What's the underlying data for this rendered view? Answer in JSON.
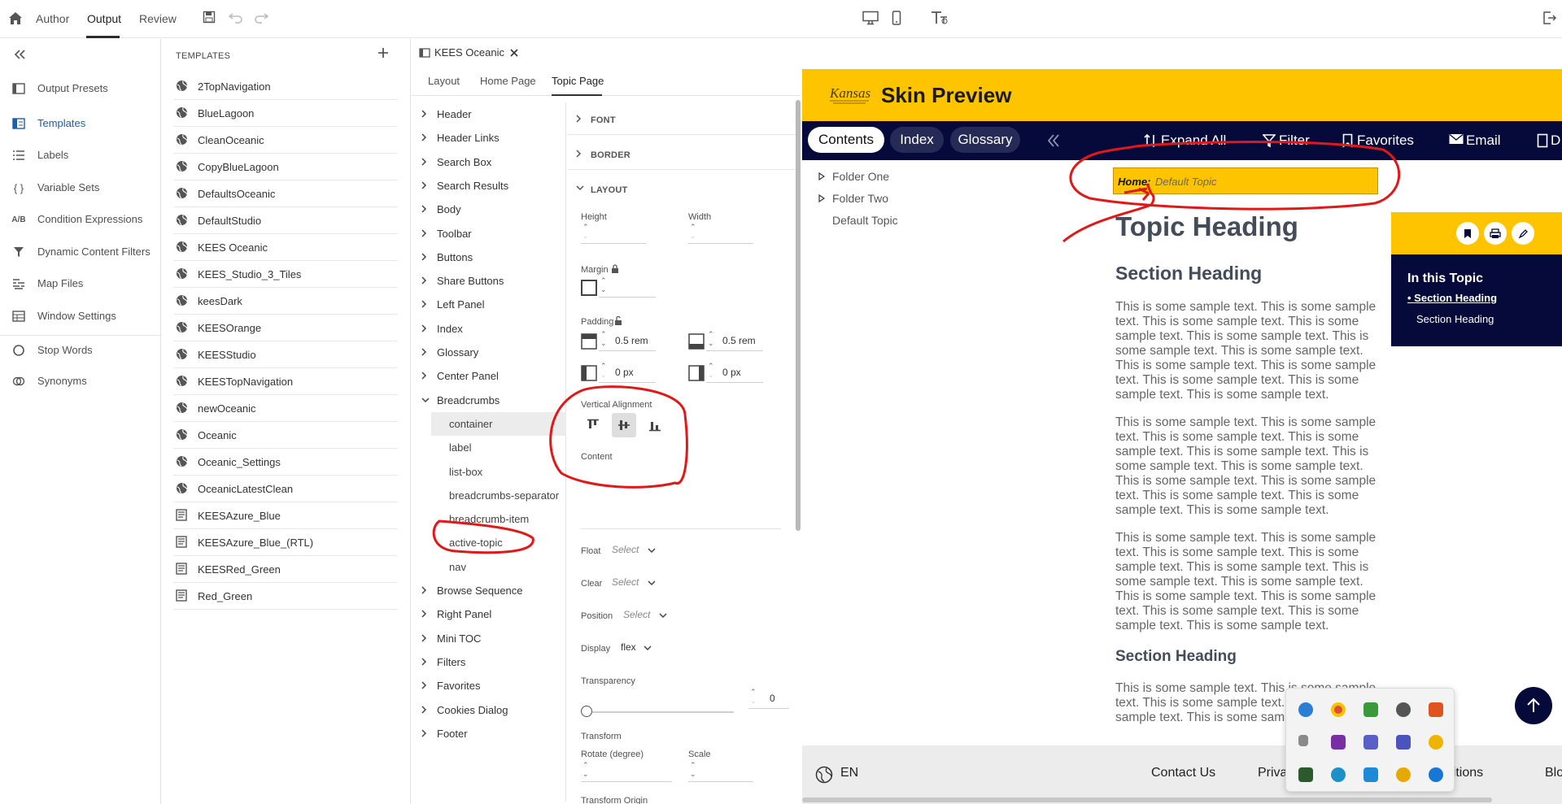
{
  "topbar": {
    "tabs": [
      {
        "label": "Author"
      },
      {
        "label": "Output"
      },
      {
        "label": "Review"
      }
    ]
  },
  "leftnav": {
    "items": [
      {
        "label": "Output Presets",
        "icon": "output-presets-icon"
      },
      {
        "label": "Templates",
        "icon": "templates-icon"
      },
      {
        "label": "Labels",
        "icon": "labels-icon"
      },
      {
        "label": "Variable Sets",
        "icon": "variable-sets-icon"
      },
      {
        "label": "Condition Expressions",
        "icon": "condition-expressions-icon",
        "glyph": "A/B"
      },
      {
        "label": "Dynamic Content Filters",
        "icon": "filter-icon"
      },
      {
        "label": "Map Files",
        "icon": "map-files-icon"
      },
      {
        "label": "Window Settings",
        "icon": "window-settings-icon"
      },
      {
        "label": "Stop Words",
        "icon": "stop-words-icon"
      },
      {
        "label": "Synonyms",
        "icon": "synonyms-icon"
      }
    ],
    "variable_sets_glyph": "{ }"
  },
  "templates": {
    "title": "TEMPLATES",
    "items": [
      {
        "label": "2TopNavigation"
      },
      {
        "label": "BlueLagoon"
      },
      {
        "label": "CleanOceanic"
      },
      {
        "label": "CopyBlueLagoon"
      },
      {
        "label": "DefaultsOceanic"
      },
      {
        "label": "DefaultStudio"
      },
      {
        "label": "KEES Oceanic"
      },
      {
        "label": "KEES_Studio_3_Tiles"
      },
      {
        "label": "keesDark"
      },
      {
        "label": "KEESOrange"
      },
      {
        "label": "KEESStudio"
      },
      {
        "label": "KEESTopNavigation"
      },
      {
        "label": "newOceanic"
      },
      {
        "label": "Oceanic"
      },
      {
        "label": "Oceanic_Settings"
      },
      {
        "label": "OceanicLatestClean"
      },
      {
        "label": "KEESAzure_Blue"
      },
      {
        "label": "KEESAzure_Blue_(RTL)"
      },
      {
        "label": "KEESRed_Green"
      },
      {
        "label": "Red_Green"
      }
    ]
  },
  "editor": {
    "tab_label": "KEES Oceanic",
    "subtabs": [
      {
        "label": "Layout"
      },
      {
        "label": "Home Page"
      },
      {
        "label": "Topic Page"
      }
    ],
    "tree": [
      {
        "label": "Header"
      },
      {
        "label": "Header Links"
      },
      {
        "label": "Search Box"
      },
      {
        "label": "Search Results"
      },
      {
        "label": "Body"
      },
      {
        "label": "Toolbar"
      },
      {
        "label": "Buttons"
      },
      {
        "label": "Share Buttons"
      },
      {
        "label": "Left Panel"
      },
      {
        "label": "Index"
      },
      {
        "label": "Glossary"
      },
      {
        "label": "Center Panel"
      },
      {
        "label": "Breadcrumbs"
      },
      {
        "label": "container"
      },
      {
        "label": "label"
      },
      {
        "label": "list-box"
      },
      {
        "label": "breadcrumbs-separator"
      },
      {
        "label": "breadcrumb-item"
      },
      {
        "label": "active-topic"
      },
      {
        "label": "nav"
      },
      {
        "label": "Browse Sequence"
      },
      {
        "label": "Right Panel"
      },
      {
        "label": "Mini TOC"
      },
      {
        "label": "Filters"
      },
      {
        "label": "Favorites"
      },
      {
        "label": "Cookies Dialog"
      },
      {
        "label": "Footer"
      }
    ]
  },
  "props": {
    "font": "FONT",
    "border": "BORDER",
    "layout": "LAYOUT",
    "height": "Height",
    "width": "Width",
    "margin": "Margin",
    "padding": "Padding",
    "pad_top": "0.5 rem",
    "pad_bottom": "0.5 rem",
    "pad_left": "0 px",
    "pad_right": "0 px",
    "vertical_alignment": "Vertical Alignment",
    "content": "Content",
    "float_label": "Float",
    "float_value": "Select",
    "clear_label": "Clear",
    "clear_value": "Select",
    "position_label": "Position",
    "position_value": "Select",
    "display_label": "Display",
    "display_value": "flex",
    "transparency": "Transparency",
    "transparency_value": "0",
    "transform": "Transform",
    "rotate": "Rotate (degree)",
    "scale": "Scale",
    "transform_origin": "Transform Origin"
  },
  "preview": {
    "logo_text": "Kansas",
    "title": "Skin Preview",
    "nav_tabs": [
      {
        "label": "Contents"
      },
      {
        "label": "Index"
      },
      {
        "label": "Glossary"
      }
    ],
    "tools": [
      {
        "label": "Expand All"
      },
      {
        "label": "Filter"
      },
      {
        "label": "Favorites"
      },
      {
        "label": "Email"
      },
      {
        "label": "D"
      }
    ],
    "toc": [
      "Folder One",
      "Folder Two",
      "Default Topic"
    ],
    "breadcrumb_home": "Home:",
    "breadcrumb_topic": "Default Topic",
    "topic_heading": "Topic Heading",
    "section_heading_1": "Section Heading",
    "section_heading_2": "Section Heading",
    "sample_paragraph": "This is some sample text. This is some sample text. This is some sample text. This is some sample text. This is some sample text. This is some sample text. This is some sample text. This is some sample text. This is some sample text. This is some sample text. This is some sample text. This is some sample text.",
    "sample_paragraph_4": "This is some sample text. This is some sample text. This is some sample text. This is some sample text. This is some sample text.",
    "mini_toc_title": "In this Topic",
    "mini_toc_items": [
      "Section Heading",
      "Section Heading"
    ],
    "footer": {
      "language": "EN",
      "contact": "Contact Us",
      "privacy": "Priva",
      "conditions": "nditions",
      "blog": "Blo"
    }
  },
  "colors": {
    "accent": "#1b5faa",
    "brand_yellow": "#ffc400",
    "brand_navy": "#060a3a",
    "annotation_red": "#e01818"
  }
}
